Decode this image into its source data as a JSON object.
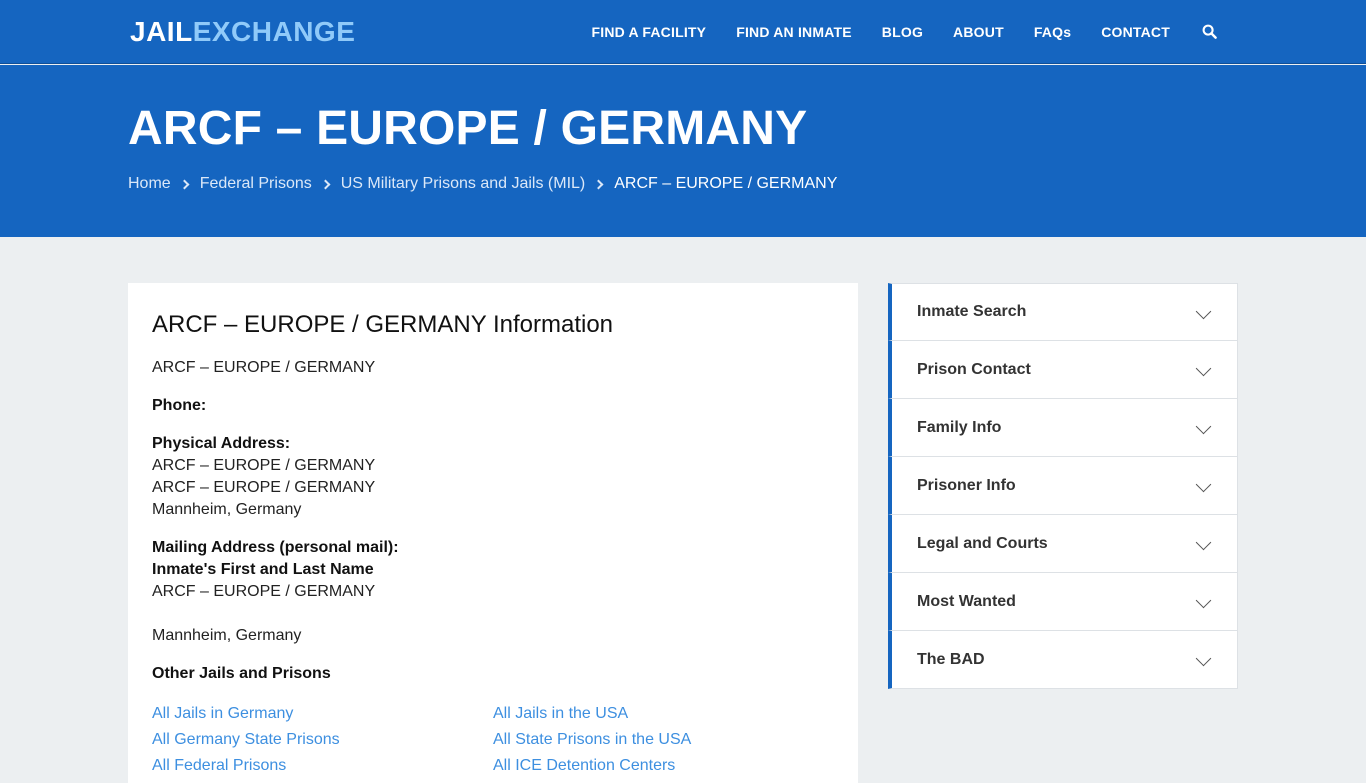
{
  "logo": {
    "part1": "JAIL",
    "part2": "EXCHANGE"
  },
  "nav": {
    "items": [
      "FIND A FACILITY",
      "FIND AN INMATE",
      "BLOG",
      "ABOUT",
      "FAQs",
      "CONTACT"
    ],
    "search_icon": "search-icon"
  },
  "hero": {
    "title": "ARCF – EUROPE / GERMANY",
    "breadcrumb": [
      "Home",
      "Federal Prisons",
      "US Military Prisons and Jails (MIL)",
      "ARCF – EUROPE / GERMANY"
    ]
  },
  "info": {
    "heading": "ARCF – EUROPE / GERMANY Information",
    "name": "ARCF – EUROPE / GERMANY",
    "phone_label": "Phone:",
    "physical_label": "Physical Address:",
    "physical_lines": [
      "ARCF – EUROPE / GERMANY",
      "ARCF – EUROPE / GERMANY",
      "Mannheim, Germany"
    ],
    "mailing_label": "Mailing Address (personal mail):",
    "mailing_name": "Inmate's First and Last Name",
    "mailing_line1": "ARCF – EUROPE / GERMANY",
    "mailing_city": "Mannheim, Germany",
    "other_label": "Other Jails and Prisons",
    "links": [
      "All Jails in Germany",
      "All Jails in the USA",
      "All Germany State Prisons",
      "All State Prisons in the USA",
      "All Federal Prisons",
      "All ICE Detention Centers"
    ]
  },
  "sidebar": {
    "items": [
      "Inmate Search",
      "Prison Contact",
      "Family Info",
      "Prisoner Info",
      "Legal and Courts",
      "Most Wanted",
      "The BAD"
    ]
  },
  "colors": {
    "primary": "#1565c0",
    "link": "#3d8fe0",
    "background": "#eceff1"
  }
}
